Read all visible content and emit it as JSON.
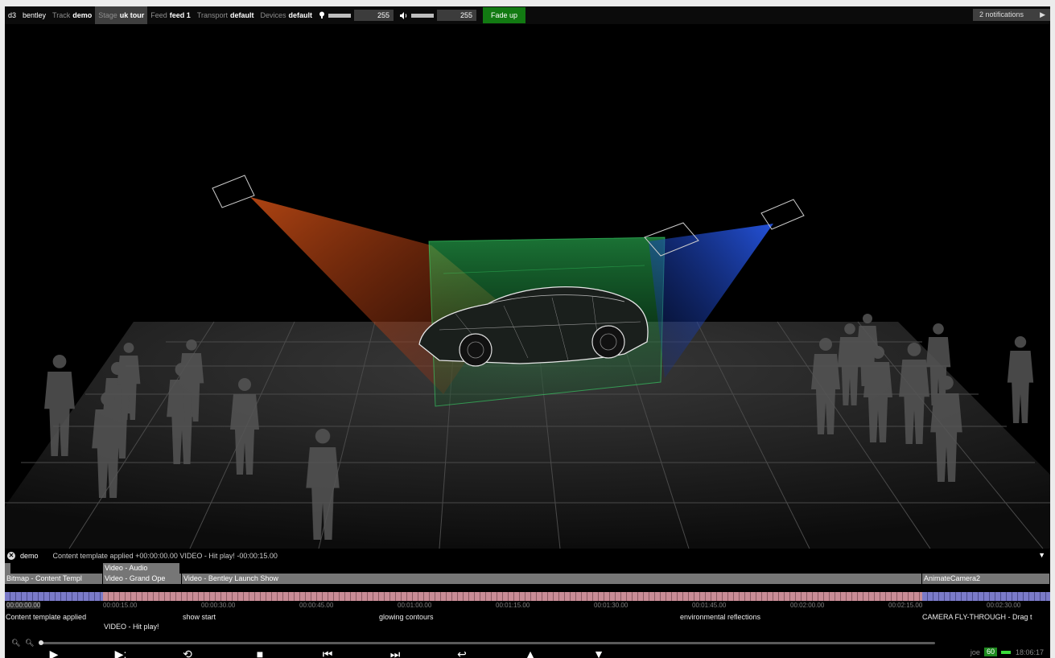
{
  "topbar": {
    "app": "d3",
    "project": "bentley",
    "track_label": "Track",
    "track_value": "demo",
    "stage_label": "Stage",
    "stage_value": "uk tour",
    "feed_label": "Feed",
    "feed_value": "feed 1",
    "transport_label": "Transport",
    "transport_value": "default",
    "devices_label": "Devices",
    "devices_value": "default",
    "brightness_value": "255",
    "volume_value": "255",
    "fade_label": "Fade up",
    "notifications": "2 notifications"
  },
  "timeline": {
    "track_name": "demo",
    "status": "Content template applied +00:00:00.00   VIDEO - Hit play! -00:00:15.00",
    "layers": {
      "audio": "Video - Audio",
      "bitmap": "Bitmap - Content Templ",
      "grand": "Video - Grand Ope",
      "launch": "Video - Bentley Launch Show",
      "camera": "AnimateCamera2"
    },
    "ticks": [
      "00:00:00.00",
      "00:00:15.00",
      "00:00:30.00",
      "00:00:45.00",
      "00:01:00.00",
      "00:01:15.00",
      "00:01:30.00",
      "00:01:45.00",
      "00:02:00.00",
      "00:02:15.00",
      "00:02:30.00"
    ],
    "notes": {
      "content": "Content template applied",
      "hitplay": "VIDEO - Hit play!",
      "showstart": "show start",
      "glowing": "glowing contours",
      "envref": "environmental reflections",
      "camera": "CAMERA FLY-THROUGH - Drag t"
    }
  },
  "statusbar": {
    "user": "joe",
    "fps": "60",
    "clock": "18:06:17"
  },
  "colors": {
    "fade_green": "#127a12",
    "projector_left": "#c8501e",
    "projector_right": "#1e50d2",
    "screen_green": "#28b450",
    "layer_pink": "#c88c96",
    "layer_blue": "#7a7ac8"
  }
}
